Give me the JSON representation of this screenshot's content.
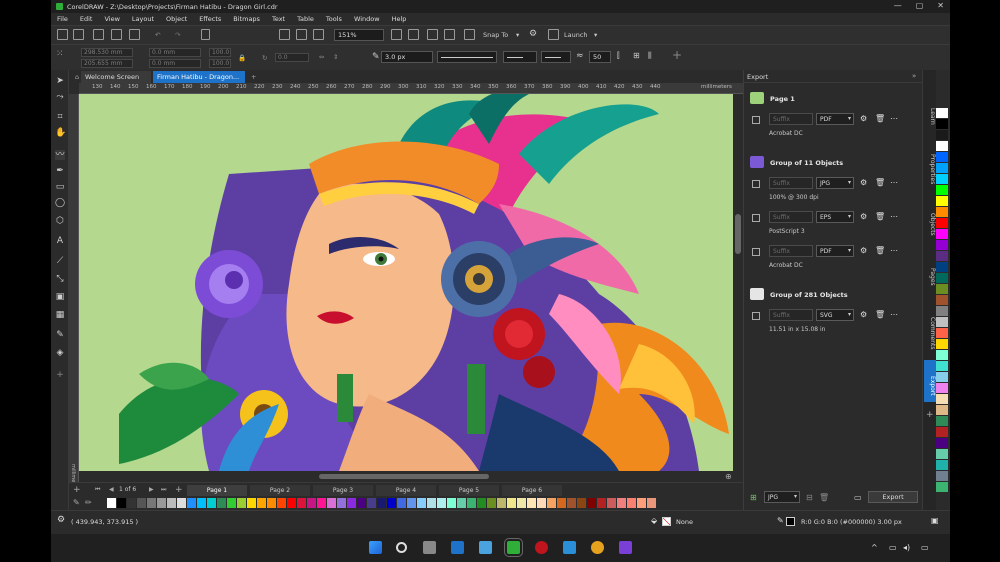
{
  "window": {
    "title": "CorelDRAW - Z:\\Desktop\\Projects\\Firman Hatibu - Dragon Girl.cdr",
    "controls": [
      "—",
      "▢",
      "✕"
    ]
  },
  "menu": {
    "items": [
      "File",
      "Edit",
      "View",
      "Layout",
      "Object",
      "Effects",
      "Bitmaps",
      "Text",
      "Table",
      "Tools",
      "Window",
      "Help"
    ]
  },
  "toolbar": {
    "zoom_value": "151%",
    "snap_label": "Snap To",
    "launch_label": "Launch"
  },
  "propbar": {
    "x_value": "298.530 mm",
    "y_value": "205.655 mm",
    "w_value": "0.0 mm",
    "h_value": "0.0 mm",
    "scale_w": "100.0",
    "scale_h": "100.0",
    "angle_value": "0.0",
    "outline_width": "3.0 px",
    "percent_value": "50"
  },
  "tabs": {
    "welcome": "Welcome Screen",
    "document": "Firman Hatibu - Dragon..."
  },
  "ruler": {
    "ticks": [
      "130",
      "140",
      "150",
      "160",
      "170",
      "180",
      "190",
      "200",
      "210",
      "220",
      "230",
      "240",
      "250",
      "260",
      "270",
      "280",
      "290",
      "300",
      "310",
      "320",
      "330",
      "340",
      "350",
      "360",
      "370",
      "380",
      "390",
      "400",
      "410",
      "420",
      "430",
      "440"
    ],
    "unit": "millimeters",
    "v_unit": "millimeters"
  },
  "pages": {
    "counter": "1 of 6",
    "tabs": [
      "Page 1",
      "Page 2",
      "Page 3",
      "Page 4",
      "Page 5",
      "Page 6"
    ]
  },
  "export": {
    "header": "Export",
    "groups": [
      {
        "title": "Page 1",
        "rows": [
          {
            "suffix": "Suffix",
            "format": "PDF",
            "detail": "Acrobat DC"
          }
        ]
      },
      {
        "title": "Group of 11 Objects",
        "rows": [
          {
            "suffix": "Suffix",
            "format": "JPG",
            "detail": "100% @ 300 dpi"
          },
          {
            "suffix": "Suffix",
            "format": "EPS",
            "detail": "PostScript 3"
          },
          {
            "suffix": "Suffix",
            "format": "PDF",
            "detail": "Acrobat DC"
          }
        ]
      },
      {
        "title": "Group of 281 Objects",
        "rows": [
          {
            "suffix": "Suffix",
            "format": "SVG",
            "detail": "11.51 in x 15.08 in"
          }
        ]
      }
    ],
    "footer_format": "JPG",
    "export_button": "Export"
  },
  "sidetabs": [
    "Learn",
    "Properties",
    "Objects",
    "Pages",
    "Comments",
    "Export"
  ],
  "palette": [
    "#ffffff",
    "#000000",
    "#1a1a1a",
    "#ffffff",
    "#0066ff",
    "#00a2ff",
    "#00d0ff",
    "#00ff00",
    "#ffff00",
    "#ff8c00",
    "#ff0000",
    "#ff00ff",
    "#9400d3",
    "#5a2d82",
    "#004080",
    "#00695c",
    "#6b8e23",
    "#a0522d",
    "#808080",
    "#c0c0c0",
    "#ff6347",
    "#ffd700",
    "#7fffd4",
    "#40e0d0",
    "#87ceeb",
    "#ee82ee",
    "#f5deb3",
    "#deb887",
    "#2e8b57",
    "#b22222",
    "#4b0082",
    "#66cdaa",
    "#20b2aa",
    "#708090",
    "#3cb371"
  ],
  "bottom_palette": [
    "#ffffff",
    "#000000",
    "#333333",
    "#555555",
    "#777777",
    "#999999",
    "#bbbbbb",
    "#dddddd",
    "#1e90ff",
    "#00bfff",
    "#00ced1",
    "#2e8b57",
    "#32cd32",
    "#9acd32",
    "#ffd700",
    "#ffa500",
    "#ff8c00",
    "#ff4500",
    "#ff0000",
    "#dc143c",
    "#c71585",
    "#ff1493",
    "#da70d6",
    "#9370db",
    "#8a2be2",
    "#4b0082",
    "#483d8b",
    "#191970",
    "#0000cd",
    "#4169e1",
    "#6495ed",
    "#87cefa",
    "#b0e0e6",
    "#afeeee",
    "#7fffd4",
    "#66cdaa",
    "#3cb371",
    "#228b22",
    "#6b8e23",
    "#bdb76b",
    "#f0e68c",
    "#eee8aa",
    "#ffe4b5",
    "#ffdab9",
    "#f4a460",
    "#d2691e",
    "#a0522d",
    "#8b4513",
    "#800000",
    "#b22222",
    "#cd5c5c",
    "#f08080",
    "#fa8072",
    "#ffa07a",
    "#e9967a"
  ],
  "status": {
    "coords": "( 439.943, 373.915 )",
    "fill_label": "None",
    "color_readout": "R:0 G:0 B:0 (#000000)  3.00 px"
  },
  "colors": {
    "canvas_bg": "#b4d88e",
    "accent": "#1e73c8",
    "orange": "#f28c28",
    "purple": "#5d3fa3",
    "teal": "#0f8a7e"
  }
}
